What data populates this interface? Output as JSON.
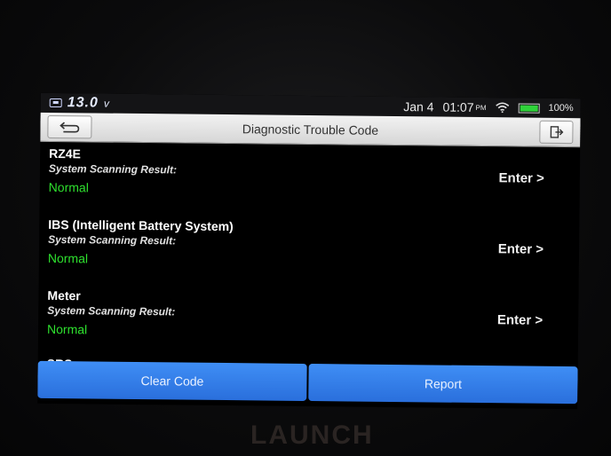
{
  "status_bar": {
    "voltage": "13.0",
    "voltage_unit": "v",
    "date": "Jan 4",
    "time": "01:07",
    "ampm": "PM",
    "battery_percent": "100%",
    "colors": {
      "battery_fill": "#2fd23a"
    }
  },
  "title_bar": {
    "title": "Diagnostic Trouble Code",
    "back_icon": "back-arrow-icon",
    "exit_icon": "exit-icon"
  },
  "systems": [
    {
      "name": "RZ4E",
      "sub_label": "System Scanning Result:",
      "status": "Normal",
      "action": "Enter >"
    },
    {
      "name": "IBS (Intelligent Battery System)",
      "sub_label": "System Scanning Result:",
      "status": "Normal",
      "action": "Enter >"
    },
    {
      "name": "Meter",
      "sub_label": "System Scanning Result:",
      "status": "Normal",
      "action": "Enter >"
    }
  ],
  "partial_item": {
    "name": "SRS"
  },
  "bottom_buttons": {
    "clear_code": "Clear Code",
    "report": "Report"
  },
  "device": {
    "brand": "LAUNCH"
  },
  "theme": {
    "accent": "#2a6fdc",
    "status_ok": "#2ee02e"
  }
}
